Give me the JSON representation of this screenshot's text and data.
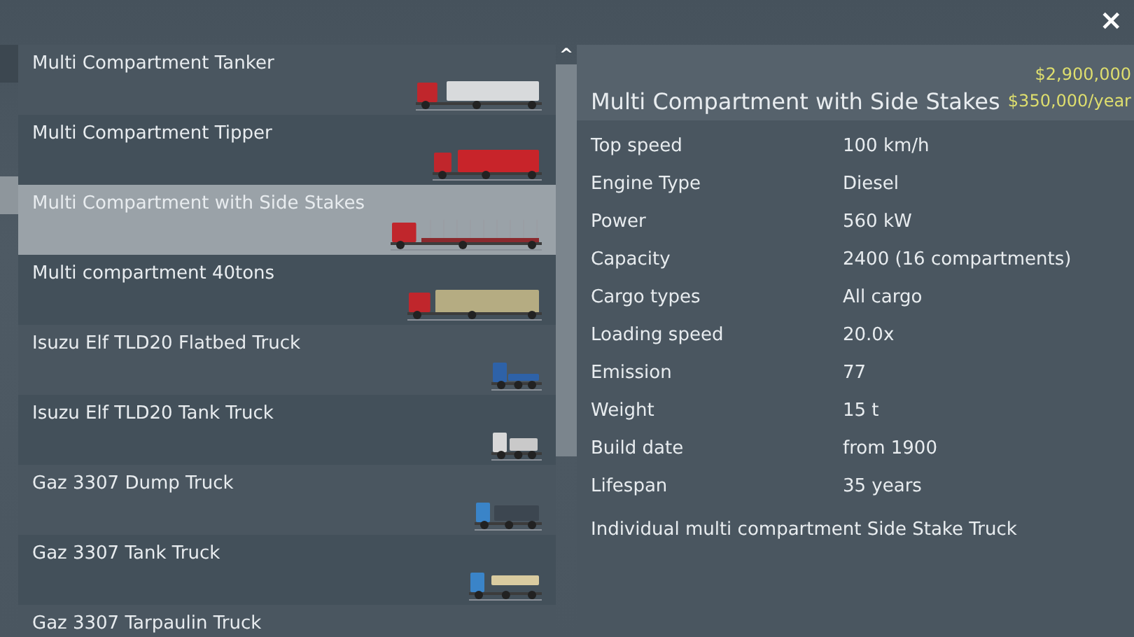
{
  "vehicles": [
    {
      "name": "Multi Compartment Tanker",
      "kind": "semi-tank",
      "selected": false
    },
    {
      "name": "Multi Compartment Tipper",
      "kind": "tipper",
      "selected": false
    },
    {
      "name": "Multi Compartment with Side Stakes",
      "kind": "semi-stakes",
      "selected": true
    },
    {
      "name": "Multi compartment 40tons",
      "kind": "semi-box",
      "selected": false
    },
    {
      "name": "Isuzu Elf TLD20 Flatbed Truck",
      "kind": "small-flatbed",
      "selected": false
    },
    {
      "name": "Isuzu Elf TLD20 Tank Truck",
      "kind": "small-tank",
      "selected": false
    },
    {
      "name": "Gaz 3307 Dump Truck",
      "kind": "dump",
      "selected": false
    },
    {
      "name": "Gaz 3307 Tank Truck",
      "kind": "tank",
      "selected": false
    },
    {
      "name": "Gaz 3307 Tarpaulin Truck",
      "kind": "tarpaulin",
      "selected": false
    }
  ],
  "detail": {
    "title": "Multi Compartment with Side Stakes",
    "price": "$2,900,000",
    "running_cost": "$350,000/year",
    "properties": [
      {
        "label": "Top speed",
        "value": "100 km/h"
      },
      {
        "label": "Engine Type",
        "value": "Diesel"
      },
      {
        "label": "Power",
        "value": "560 kW"
      },
      {
        "label": "Capacity",
        "value": "2400 (16 compartments)"
      },
      {
        "label": "Cargo types",
        "value": "All cargo"
      },
      {
        "label": "Loading speed",
        "value": "20.0x"
      },
      {
        "label": "Emission",
        "value": "77"
      },
      {
        "label": "Weight",
        "value": "15 t"
      },
      {
        "label": "Build date",
        "value": "from 1900"
      },
      {
        "label": "Lifespan",
        "value": "35 years"
      }
    ],
    "description": "Individual multi compartment Side Stake Truck"
  },
  "close_label": "×",
  "scroll_up_label": "^"
}
